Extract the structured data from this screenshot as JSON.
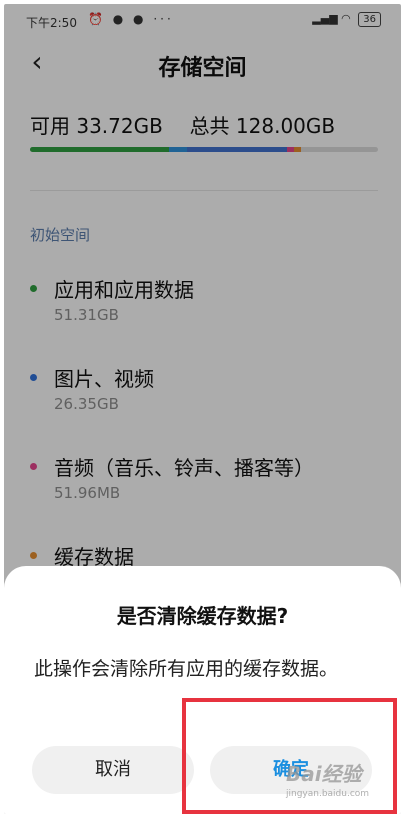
{
  "status_bar": {
    "time": "下午2:50",
    "left_icons": [
      "alarm-icon",
      "chat-icon",
      "wechat-icon",
      "more-icon"
    ],
    "left_glyphs": "⏰ ● ● ···",
    "right_glyphs": "▂▄▆ ◠",
    "battery": "36"
  },
  "header": {
    "back_glyph": "‹",
    "title": "存储空间"
  },
  "summary": {
    "available_label": "可用",
    "available_value": "33.72GB",
    "total_label": "总共",
    "total_value": "128.00GB"
  },
  "usage_bar": {
    "segments": [
      {
        "name": "apps",
        "color": "#2e9b3f",
        "fraction": 0.4
      },
      {
        "name": "images",
        "color": "#2f8fd6",
        "fraction": 0.05
      },
      {
        "name": "mixed",
        "color": "#3f6fc9",
        "fraction": 0.29
      },
      {
        "name": "audio",
        "color": "#e0448a",
        "fraction": 0.02
      },
      {
        "name": "cache",
        "color": "#e08a2e",
        "fraction": 0.02
      }
    ],
    "track_color": "#d6d6d6"
  },
  "section_title": "初始空间",
  "items": [
    {
      "name": "应用和应用数据",
      "size": "51.31GB",
      "color": "#2e9b3f"
    },
    {
      "name": "图片、视频",
      "size": "26.35GB",
      "color": "#2f6fd6"
    },
    {
      "name": "音频（音乐、铃声、播客等）",
      "size": "51.96MB",
      "color": "#e0448a"
    },
    {
      "name": "缓存数据",
      "size": "",
      "color": "#e08a2e"
    }
  ],
  "dialog": {
    "title": "是否清除缓存数据?",
    "message": "此操作会清除所有应用的缓存数据。",
    "cancel_label": "取消",
    "confirm_label": "确定"
  },
  "watermark": {
    "main": "Bai经验",
    "sub": "jingyan.baidu.com"
  },
  "colors": {
    "accent": "#1b8fe0",
    "highlight": "#e7333f"
  }
}
